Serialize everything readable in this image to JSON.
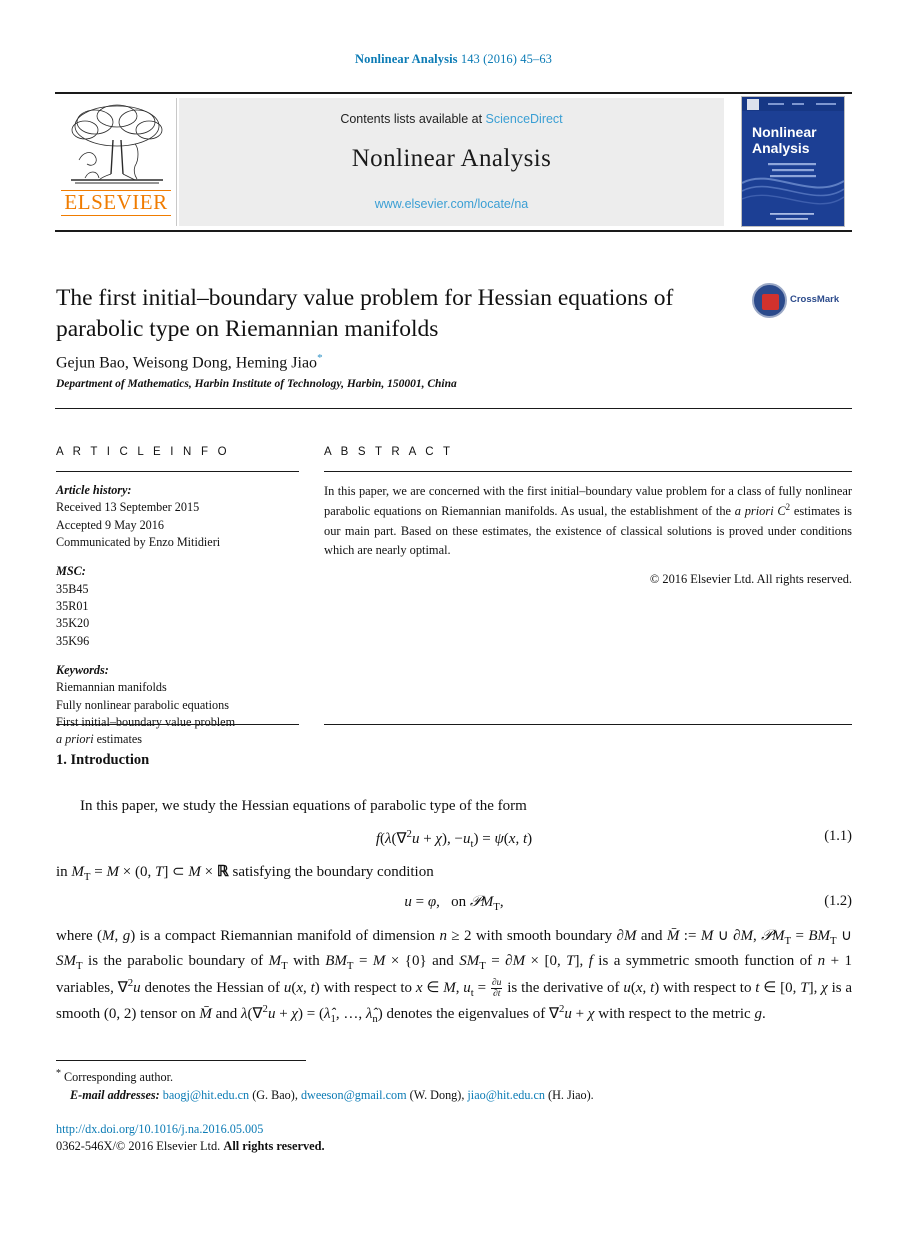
{
  "running_head": {
    "journal": "Nonlinear Analysis",
    "citation": "143 (2016) 45–63",
    "color": "#0b7bb5"
  },
  "banner": {
    "contents_prefix": "Contents lists available at",
    "sciencedirect": "ScienceDirect",
    "journal_name": "Nonlinear Analysis",
    "journal_url": "www.elsevier.com/locate/na",
    "publisher": "ELSEVIER",
    "cover_title_line1": "Nonlinear",
    "cover_title_line2": "Analysis",
    "background": "#ededed",
    "link_color": "#3b9fd4",
    "publisher_color": "#f07c00"
  },
  "article": {
    "title": "The first initial–boundary value problem for Hessian equations of parabolic type on Riemannian manifolds",
    "authors": "Gejun Bao, Weisong Dong, Heming Jiao",
    "author_marker": "*",
    "affiliation": "Department of Mathematics, Harbin Institute of Technology, Harbin, 150001, China",
    "crossmark_label": "CrossMark"
  },
  "info": {
    "heading": "A R T I C L E   I N F O",
    "history_label": "Article history:",
    "history": [
      "Received 13 September 2015",
      "Accepted 9 May 2016",
      "Communicated by Enzo Mitidieri"
    ],
    "msc_label": "MSC:",
    "msc": [
      "35B45",
      "35R01",
      "35K20",
      "35K96"
    ],
    "keywords_label": "Keywords:",
    "keywords": [
      "Riemannian manifolds",
      "Fully nonlinear parabolic equations",
      "First initial–boundary value problem"
    ],
    "keyword_italic_head": "a priori",
    "keyword_italic_tail": " estimates"
  },
  "abstract": {
    "heading": "A B S T R A C T",
    "part1": "In this paper, we are concerned with the first initial–boundary value problem for a class of fully nonlinear parabolic equations on Riemannian manifolds. As usual, the establishment of the ",
    "italic_term": "a priori",
    "part2": " estimates is our main part. Based on these estimates, the existence of classical solutions is proved under conditions which are nearly optimal.",
    "c_symbol": "C",
    "c_exponent": "2",
    "copyright": "© 2016 Elsevier Ltd. All rights reserved."
  },
  "body": {
    "section_number_title": "1.  Introduction",
    "paragraph1": "In this paper, we study the Hessian equations of parabolic type of the form",
    "equation1_number": "(1.1)",
    "paragraph2_lead": "in ",
    "paragraph2_rest": " satisfying the boundary condition",
    "equation2_number": "(1.2)",
    "paragraph3": "where (M, g) is a compact Riemannian manifold of dimension n ≥ 2 with smooth boundary ∂M and M̄ := M ∪ ∂M, 𝒫M_T = BM_T ∪ SM_T is the parabolic boundary of M_T with BM_T = M × {0} and SM_T = ∂M × [0, T], f is a symmetric smooth function of n + 1 variables, ∇²u denotes the Hessian of u(x,t) with respect to x ∈ M, u_t = ∂u/∂t is the derivative of u(x,t) with respect to t ∈ [0, T], χ is a smooth (0, 2) tensor on M̄ and λ(∇²u + χ) = (λ̂₁, …, λ̂_n) denotes the eigenvalues of ∇²u + χ with respect to the metric g."
  },
  "footer": {
    "corresponding_marker": "*",
    "corresponding_text": "Corresponding author.",
    "email_label": "E-mail addresses:",
    "emails": [
      {
        "address": "baogj@hit.edu.cn",
        "person": "(G. Bao)"
      },
      {
        "address": "dweeson@gmail.com",
        "person": "(W. Dong)"
      },
      {
        "address": "jiao@hit.edu.cn",
        "person": "(H. Jiao)."
      }
    ],
    "doi": "http://dx.doi.org/10.1016/j.na.2016.05.005",
    "issn_copyright_plain": "0362-546X/© 2016 Elsevier Ltd. ",
    "issn_copyright_bold": "All rights reserved."
  }
}
